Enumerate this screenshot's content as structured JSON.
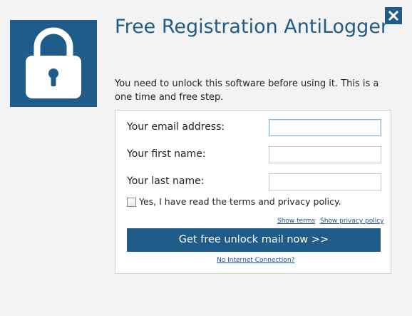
{
  "app": {
    "title": "Free Registration AntiLogger",
    "intro": "You need to unlock this software before using it. This is a one time and free step.",
    "logo_icon": "padlock-icon",
    "close_icon": "close-icon"
  },
  "form": {
    "email_label": "Your email address:",
    "email_value": "",
    "first_name_label": "Your first name:",
    "first_name_value": "",
    "last_name_label": "Your last name:",
    "last_name_value": "",
    "terms_checkbox_label": "Yes, I have read the terms and privacy policy.",
    "terms_checked": false,
    "show_terms_link": "Show terms",
    "show_privacy_link": "Show privacy policy",
    "submit_label": "Get free unlock mail now >>",
    "no_internet_link": "No Internet Connection?"
  },
  "colors": {
    "accent": "#1f5c8a",
    "background": "#f3f3f3",
    "link": "#1a4fa0"
  }
}
